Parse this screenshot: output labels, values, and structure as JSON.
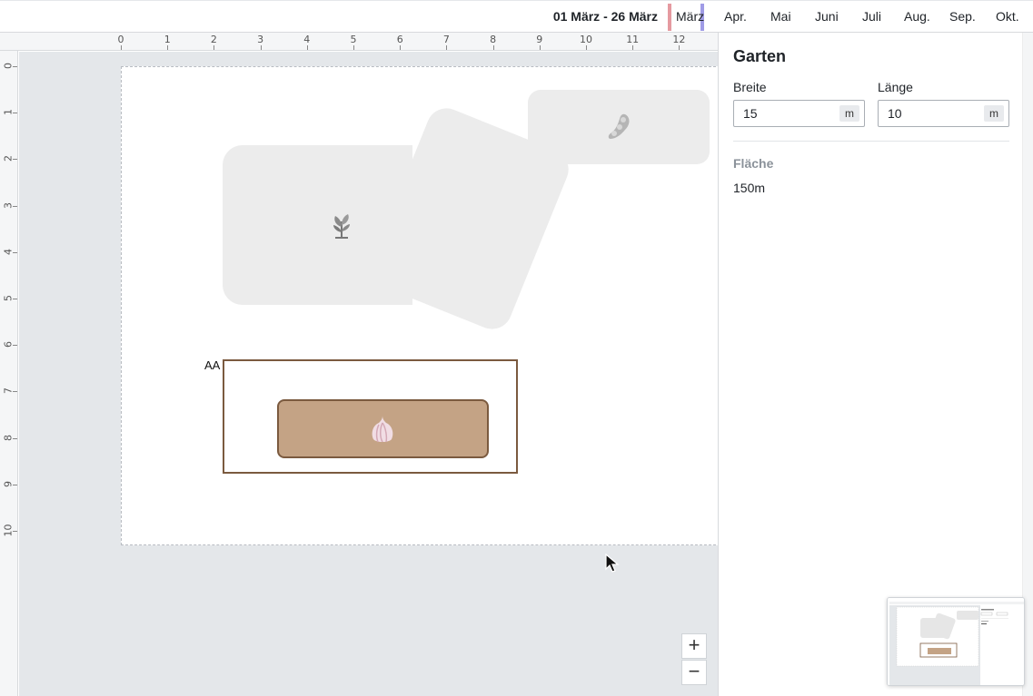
{
  "timeline": {
    "range_label": "01 März - 26 März",
    "months": [
      "März",
      "Apr.",
      "Mai",
      "Juni",
      "Juli",
      "Aug.",
      "Sep.",
      "Okt."
    ]
  },
  "ruler": {
    "x_ticks": [
      "0",
      "1",
      "2",
      "3",
      "4",
      "5",
      "6",
      "7",
      "8",
      "9",
      "10",
      "11",
      "12"
    ],
    "y_ticks": [
      "0",
      "1",
      "2",
      "3",
      "4",
      "5",
      "6",
      "7",
      "8",
      "9",
      "10"
    ]
  },
  "canvas": {
    "bed_label": "AA",
    "icons": {
      "bed1": "seedling-icon",
      "bed2": "bean-icon",
      "bed3": "garlic-icon"
    }
  },
  "zoom": {
    "in_label": "+",
    "out_label": "−"
  },
  "panel": {
    "title": "Garten",
    "width_label": "Breite",
    "width_value": "15",
    "width_unit": "m",
    "length_label": "Länge",
    "length_value": "10",
    "length_unit": "m",
    "area_label": "Fläche",
    "area_value": "150m"
  },
  "colors": {
    "accent_start": "#e59aa0",
    "accent_end": "#a09ce6",
    "bed_brown": "#c4a385",
    "bed_border": "#7b5a3f"
  }
}
